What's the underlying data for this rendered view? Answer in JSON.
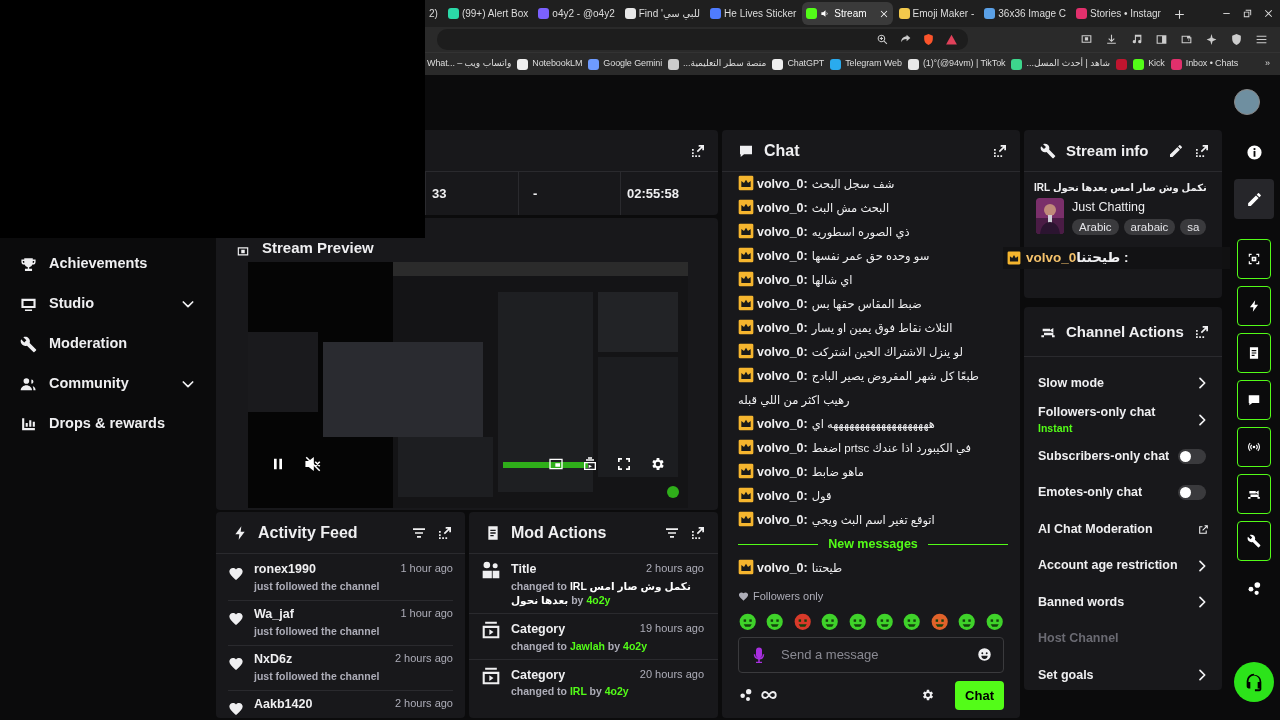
{
  "browser": {
    "tabs": [
      {
        "title": "2)",
        "selected": false
      },
      {
        "title": "(99+) Alert Box",
        "color": "#2bd9a8",
        "selected": false
      },
      {
        "title": "o4y2 - @o4y2",
        "color": "#7b61ff",
        "selected": false
      },
      {
        "title": "Find 'للبي سي",
        "color": "#e8e8e8",
        "selected": false
      },
      {
        "title": "He Lives Sticker",
        "color": "#4f7cff",
        "selected": false
      },
      {
        "title": "Stream",
        "color": "#53fc18",
        "selected": true
      },
      {
        "title": "Emoji Maker -",
        "color": "#f2c94c",
        "selected": false
      },
      {
        "title": "36x36 Image C",
        "color": "#5aa0e6",
        "selected": false
      },
      {
        "title": "Stories • Instagr",
        "color": "#e1306c",
        "selected": false
      }
    ],
    "bookmarks": [
      {
        "label": "What... – واتساب ويب"
      },
      {
        "label": "NotebookLM",
        "color": "#f0f0f0"
      },
      {
        "label": "Google Gemini",
        "color": "#6e9bff"
      },
      {
        "label": "منصة سطر التعليمية...",
        "color": "#cccccc"
      },
      {
        "label": "ChatGPT",
        "color": "#f0f0f0"
      },
      {
        "label": "Telegram Web",
        "color": "#2aabee"
      },
      {
        "label": "(1)°(@94vm) | TikTok",
        "color": "#e8e8e8"
      },
      {
        "label": "شاهد | أحدث المسل...",
        "color": "#3dd68c"
      },
      {
        "color": "#c0152f"
      },
      {
        "label": "Kick",
        "color": "#53fc18"
      },
      {
        "label": "Inbox • Chats",
        "color": "#e1306c"
      }
    ],
    "bookmarks_more": "»"
  },
  "left_nav": [
    {
      "label": "Achievements",
      "expandable": false
    },
    {
      "label": "Studio",
      "expandable": true
    },
    {
      "label": "Moderation",
      "expandable": false
    },
    {
      "label": "Community",
      "expandable": true
    },
    {
      "label": "Drops & rewards",
      "expandable": false
    }
  ],
  "stats": [
    "33",
    "-",
    "02:55:58"
  ],
  "stream_preview": {
    "title": "Stream Preview",
    "playing": true,
    "muted": true
  },
  "activity_feed": {
    "title": "Activity Feed",
    "items": [
      {
        "name": "ronex1990",
        "time": "1 hour ago",
        "action": "just followed the channel"
      },
      {
        "name": "Wa_jaf",
        "time": "1 hour ago",
        "action": "just followed the channel"
      },
      {
        "name": "NxD6z",
        "time": "2 hours ago",
        "action": "just followed the channel"
      },
      {
        "name": "Aakb1420",
        "time": "2 hours ago"
      }
    ]
  },
  "mod_actions": {
    "title": "Mod Actions",
    "items": [
      {
        "kind": "title",
        "label": "Title",
        "time": "2 hours ago",
        "detail": [
          {
            "text": "changed to ",
            "kind": "muted"
          },
          {
            "text": "IRL نكمل وش صار امس بعدها نحول",
            "kind": "strong"
          },
          {
            "text": " by ",
            "kind": "muted"
          },
          {
            "text": "4o2y",
            "kind": "accent"
          }
        ]
      },
      {
        "kind": "category",
        "label": "Category",
        "time": "19 hours ago",
        "detail": [
          {
            "text": "changed to ",
            "kind": "muted"
          },
          {
            "text": "Jawlah",
            "kind": "accent"
          },
          {
            "text": " by ",
            "kind": "muted"
          },
          {
            "text": "4o2y",
            "kind": "accent"
          }
        ]
      },
      {
        "kind": "category",
        "label": "Category",
        "time": "20 hours ago",
        "detail": [
          {
            "text": "changed to ",
            "kind": "muted"
          },
          {
            "text": "IRL",
            "kind": "accent"
          },
          {
            "text": " by ",
            "kind": "muted"
          },
          {
            "text": "4o2y",
            "kind": "accent"
          }
        ]
      }
    ]
  },
  "chat": {
    "title": "Chat",
    "messages": [
      {
        "user": "volvo_0:",
        "text": "شف سجل البحث"
      },
      {
        "user": "volvo_0:",
        "text": "البحث مش البث"
      },
      {
        "user": "volvo_0:",
        "text": "ذي الصوره اسطوريه"
      },
      {
        "user": "volvo_0:",
        "text": "سو وحده حق عمر نفسها"
      },
      {
        "user": "volvo_0:",
        "text": "اي شالها"
      },
      {
        "user": "volvo_0:",
        "text": "ضبط المقاس حقها بس"
      },
      {
        "user": "volvo_0:",
        "text": "الثلاث نقاط فوق يمين او يسار"
      },
      {
        "user": "volvo_0:",
        "text": "لو ينزل الاشتراك الحين اشتركت"
      },
      {
        "user": "volvo_0:",
        "text": "طبعًا كل شهر المفروض يصير البادج رهيب اكثر من اللي قبله"
      },
      {
        "user": "volvo_0:",
        "text": "هههههههههههههههههههه اي"
      },
      {
        "user": "volvo_0:",
        "text": "في الكيبورد اذا عندك prtsc اضغط"
      },
      {
        "user": "volvo_0:",
        "text": "ماهو ضابط"
      },
      {
        "user": "volvo_0:",
        "text": "قول"
      },
      {
        "user": "volvo_0:",
        "text": "اتوقع تغير اسم البث ويجي"
      }
    ],
    "new_messages_label": "New messages",
    "new_messages": [
      {
        "user": "volvo_0:",
        "text": "طيحتنا"
      }
    ],
    "followers_only": "Followers only",
    "placeholder": "Send a message",
    "send_label": "Chat"
  },
  "pinned_overlay": {
    "user": "volvo_0",
    "text": " : طيحتنا"
  },
  "stream_info": {
    "title": "Stream info",
    "stream_title": "نكمل وش صار امس بعدها نحول IRL",
    "category": "Just Chatting",
    "tags": [
      "Arabic",
      "arabaic",
      "sa"
    ]
  },
  "channel_actions": {
    "title": "Channel Actions",
    "items": [
      {
        "label": "Slow mode",
        "kind": "chevron",
        "disabled": false
      },
      {
        "label": "Followers-only chat",
        "sub": "Instant",
        "kind": "chevron",
        "disabled": false
      },
      {
        "label": "Subscribers-only chat",
        "kind": "toggle",
        "on": false,
        "disabled": false
      },
      {
        "label": "Emotes-only chat",
        "kind": "toggle",
        "on": false,
        "disabled": false
      },
      {
        "label": "AI Chat Moderation",
        "kind": "external",
        "disabled": false
      },
      {
        "label": "Account age restriction",
        "kind": "chevron",
        "disabled": false
      },
      {
        "label": "Banned words",
        "kind": "chevron",
        "disabled": false
      },
      {
        "label": "Host Channel",
        "kind": "none",
        "disabled": true
      },
      {
        "label": "Set goals",
        "kind": "chevron",
        "disabled": false
      }
    ]
  },
  "right_rail": [
    {
      "kind": "info",
      "selected": false,
      "highlighted": false
    },
    {
      "kind": "pencil",
      "selected": false,
      "highlighted": true
    },
    {
      "kind": "capture",
      "selected": true,
      "highlighted": false
    },
    {
      "kind": "lightning",
      "selected": true,
      "highlighted": false
    },
    {
      "kind": "note",
      "selected": true,
      "highlighted": false
    },
    {
      "kind": "chat",
      "selected": true,
      "highlighted": false
    },
    {
      "kind": "broadcast",
      "selected": true,
      "highlighted": false
    },
    {
      "kind": "actions",
      "selected": true,
      "highlighted": false
    },
    {
      "kind": "wrench",
      "selected": true,
      "highlighted": false
    },
    {
      "kind": "dots",
      "selected": false,
      "highlighted": false
    }
  ]
}
